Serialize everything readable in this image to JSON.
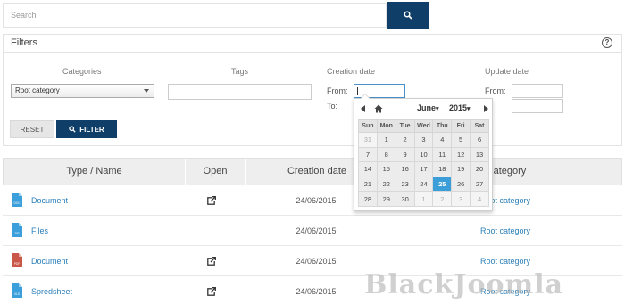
{
  "search": {
    "placeholder": "Search"
  },
  "filters": {
    "title": "Filters",
    "help": "?",
    "categories_label": "Categories",
    "category_selected": "Root category",
    "tags_label": "Tags",
    "creation_label": "Creation date",
    "update_label": "Update date",
    "from_label": "From:",
    "to_label": "To:",
    "reset_label": "RESET",
    "filter_label": "FILTER"
  },
  "datepicker": {
    "month": "June",
    "year": "2015",
    "weekdays": [
      "Sun",
      "Mon",
      "Tue",
      "Wed",
      "Thu",
      "Fri",
      "Sat"
    ],
    "weeks": [
      [
        "31",
        "1",
        "2",
        "3",
        "4",
        "5",
        "6"
      ],
      [
        "7",
        "8",
        "9",
        "10",
        "11",
        "12",
        "13"
      ],
      [
        "14",
        "15",
        "16",
        "17",
        "18",
        "19",
        "20"
      ],
      [
        "21",
        "22",
        "23",
        "24",
        "25",
        "26",
        "27"
      ],
      [
        "28",
        "29",
        "30",
        "1",
        "2",
        "3",
        "4"
      ]
    ],
    "selected_day": "25"
  },
  "table": {
    "headers": [
      "Type / Name",
      "Open",
      "Creation date",
      "Category"
    ],
    "rows": [
      {
        "icon_label": "DOC",
        "icon_color": "#3a9fdb",
        "name": "Document",
        "open": true,
        "date": "24/06/2015",
        "category": "Root category"
      },
      {
        "icon_label": "ZIP",
        "icon_color": "#3a9fdb",
        "name": "Files",
        "open": false,
        "date": "24/06/2015",
        "category": "Root category"
      },
      {
        "icon_label": "PDF",
        "icon_color": "#c9584a",
        "name": "Document",
        "open": true,
        "date": "24/06/2015",
        "category": "Root category"
      },
      {
        "icon_label": "XLS",
        "icon_color": "#3a9fdb",
        "name": "Spredsheet",
        "open": true,
        "date": "24/06/2015",
        "category": "Root category"
      }
    ]
  },
  "watermark": "BlackJoomla",
  "colors": {
    "primary": "#0f3f69",
    "link": "#2b7fb8",
    "today": "#3b9ed9"
  }
}
